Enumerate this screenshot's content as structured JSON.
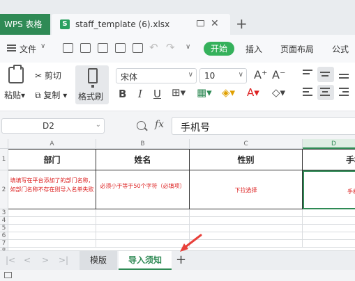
{
  "app": {
    "name": "WPS 表格"
  },
  "tabs": {
    "file_name": "staff_template (6).xlsx",
    "file_icon": "S"
  },
  "menu": {
    "file": "文件",
    "start": "开始",
    "insert": "插入",
    "page_layout": "页面布局",
    "formula": "公式"
  },
  "ribbon": {
    "paste": "粘贴",
    "cut": "剪切",
    "copy": "复制",
    "format_painter": "格式刷",
    "font_name": "宋体",
    "font_size": "10"
  },
  "formula_bar": {
    "name_box": "D2",
    "fx": "fx",
    "content": "手机号"
  },
  "grid": {
    "columns": [
      "A",
      "B",
      "C",
      "D"
    ],
    "rows": [
      "1",
      "2",
      "3",
      "4",
      "5",
      "6",
      "7",
      "8",
      "9"
    ],
    "headers": [
      "部门",
      "姓名",
      "性别",
      "手机"
    ],
    "notes": [
      "填填写在平台添加了的部门名称，如部门名称不存在则导入名单失败",
      "必须小于等于50个字符（必填项）",
      "下拉选择",
      "手机"
    ]
  },
  "sheets": {
    "tabs": [
      "模版",
      "导入须知"
    ],
    "active": "导入须知",
    "add": "+"
  },
  "colors": {
    "accent": "#2f8a55",
    "note_red": "#dd2222"
  }
}
